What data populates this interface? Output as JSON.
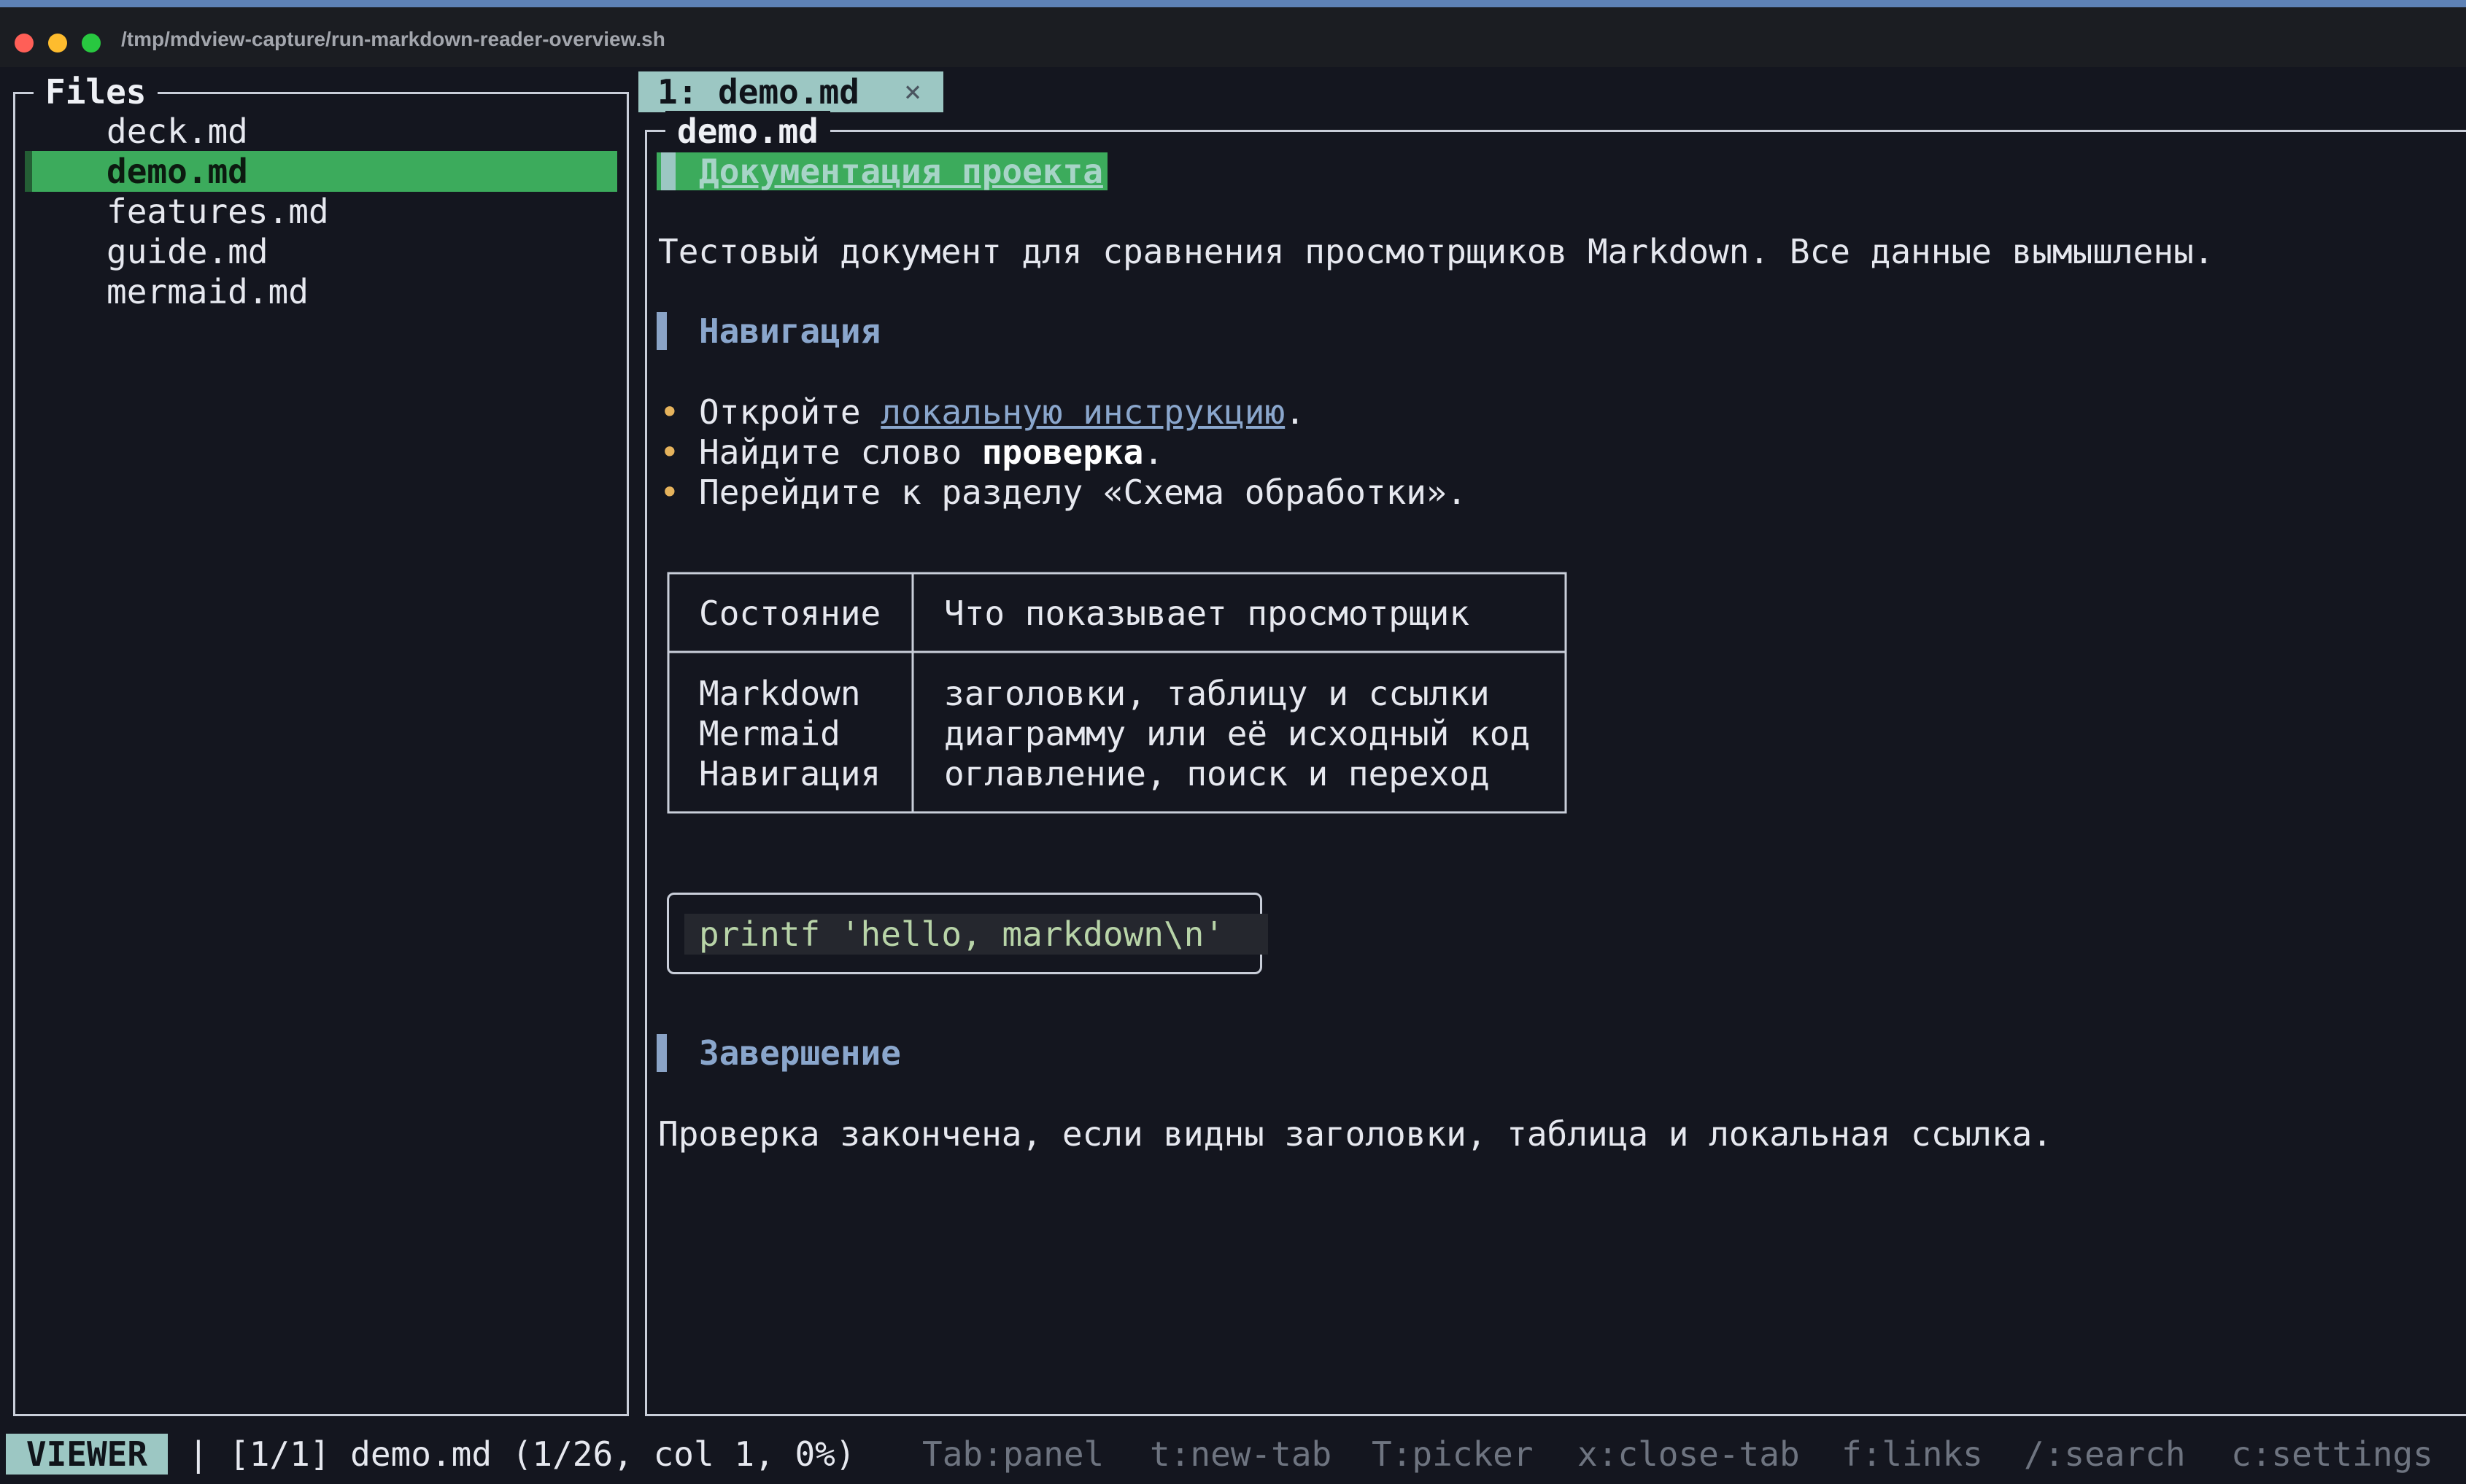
{
  "window": {
    "title": "/tmp/mdview-capture/run-markdown-reader-overview.sh"
  },
  "sidebar": {
    "title": "Files",
    "files": [
      "deck.md",
      "demo.md",
      "features.md",
      "guide.md",
      "mermaid.md"
    ],
    "selected_index": 1
  },
  "tabs": [
    {
      "label": "1: demo.md",
      "close_icon": "×"
    }
  ],
  "document": {
    "panel_title": "demo.md",
    "h1": "Документация проекта",
    "intro": "Тестовый документ для сравнения просмотрщиков Markdown. Все данные вымышлены.",
    "section_nav": "Навигация",
    "bullets": [
      {
        "before": "Откройте ",
        "link": "локальную инструкцию",
        "after": "."
      },
      {
        "before": "Найдите слово ",
        "bold": "проверка",
        "after": "."
      },
      {
        "text": "Перейдите к разделу «Схема обработки»."
      }
    ],
    "table": {
      "headers": [
        "Состояние",
        "Что показывает просмотрщик"
      ],
      "rows": [
        [
          "Markdown",
          "заголовки, таблицу и ссылки"
        ],
        [
          "Mermaid",
          "диаграмму или её исходный код"
        ],
        [
          "Навигация",
          "оглавление, поиск и переход"
        ]
      ]
    },
    "code": "printf 'hello, markdown\\n'",
    "section_end": "Завершение",
    "outro": "Проверка закончена, если видны заголовки, таблица и локальная ссылка."
  },
  "status": {
    "mode": "VIEWER",
    "separator": "|",
    "position": "[1/1] demo.md (1/26, col 1, 0%)",
    "hints": [
      "Tab:panel",
      "t:new-tab",
      "T:picker",
      "x:close-tab",
      "f:links",
      "/:search",
      "c:settings"
    ]
  },
  "colors": {
    "background": "#14161f",
    "selection": "#3cab5c",
    "tab_active": "#9cc7c3",
    "heading": "#8aa6cc",
    "link": "#8aa6cc",
    "bullet": "#e6b35c",
    "code_text": "#b8d4a8"
  }
}
